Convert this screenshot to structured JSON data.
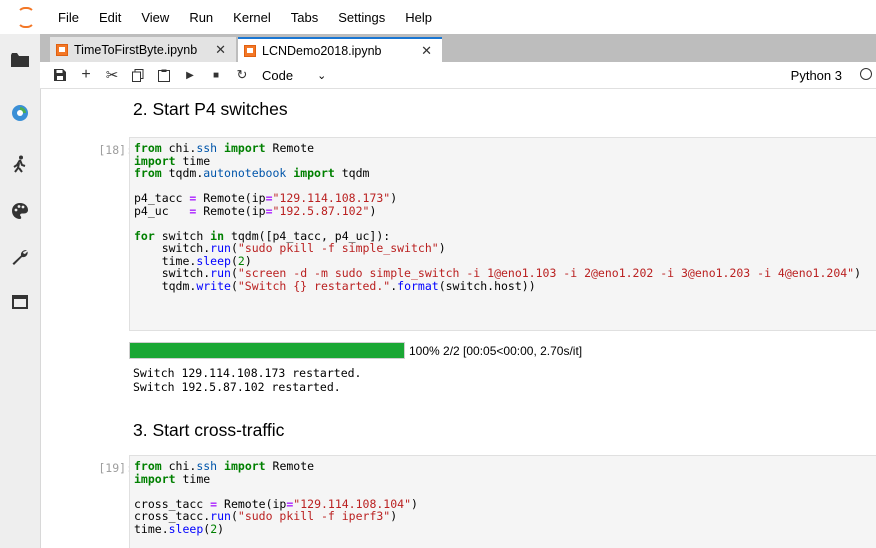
{
  "menubar": {
    "items": [
      "File",
      "Edit",
      "View",
      "Run",
      "Kernel",
      "Tabs",
      "Settings",
      "Help"
    ]
  },
  "sidebar": {
    "icons": [
      "folder-icon",
      "running-kernels-icon",
      "commands-icon",
      "palette-icon",
      "wrench-icon",
      "tabs-icon"
    ]
  },
  "tabs": [
    {
      "label": "TimeToFirstByte.ipynb",
      "active": false
    },
    {
      "label": "LCNDemo2018.ipynb",
      "active": true
    }
  ],
  "toolbar": {
    "cell_type": "Code",
    "kernel": "Python 3"
  },
  "cells": {
    "heading1": "2. Start P4 switches",
    "prompt1": "[18]:",
    "progress": {
      "percent": 100,
      "text": "100% 2/2 [00:05<00:00, 2.70s/it]"
    },
    "output1": "Switch 129.114.108.173 restarted.\nSwitch 192.5.87.102 restarted.",
    "heading2": "3. Start cross-traffic",
    "prompt2": "[19]:"
  },
  "colors": {
    "accent": "#1976d2",
    "brand": "#f37726",
    "progress_fill": "#1aa734"
  }
}
